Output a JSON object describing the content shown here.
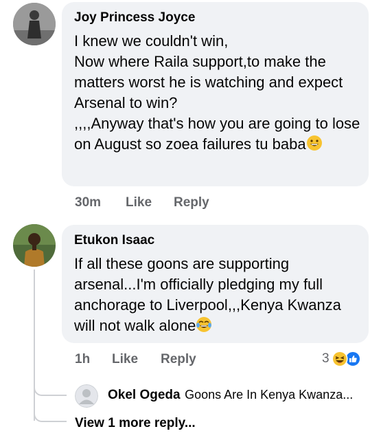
{
  "comments": [
    {
      "author": "Joy Princess Joyce",
      "text": "I knew we couldn't win,\nNow where Raila support,to make the matters worst he is watching and expect Arsenal to win?\n,,,,Anyway that's how you are going to lose on August so zoea failures tu baba",
      "emoji": "grinning-face-emoji",
      "time": "30m",
      "like_label": "Like",
      "reply_label": "Reply"
    },
    {
      "author": "Etukon Isaac",
      "text": "If all these goons are supporting arsenal...I'm officially pledging my full anchorage to Liverpool,,,Kenya Kwanza will not walk alone",
      "emoji": "tears-of-joy-emoji",
      "time": "1h",
      "like_label": "Like",
      "reply_label": "Reply",
      "reaction_count": "3",
      "reactions": [
        "haha-reaction-icon",
        "like-reaction-icon"
      ]
    }
  ],
  "reply_preview": {
    "author": "Okel Ogeda",
    "text": "Goons Are In Kenya Kwanza..."
  },
  "view_more_label": "View 1 more reply...",
  "colors": {
    "bubble": "#f0f2f5",
    "meta": "#65676b",
    "like_blue": "#1877f2",
    "emoji_yellow": "#f7c330"
  }
}
